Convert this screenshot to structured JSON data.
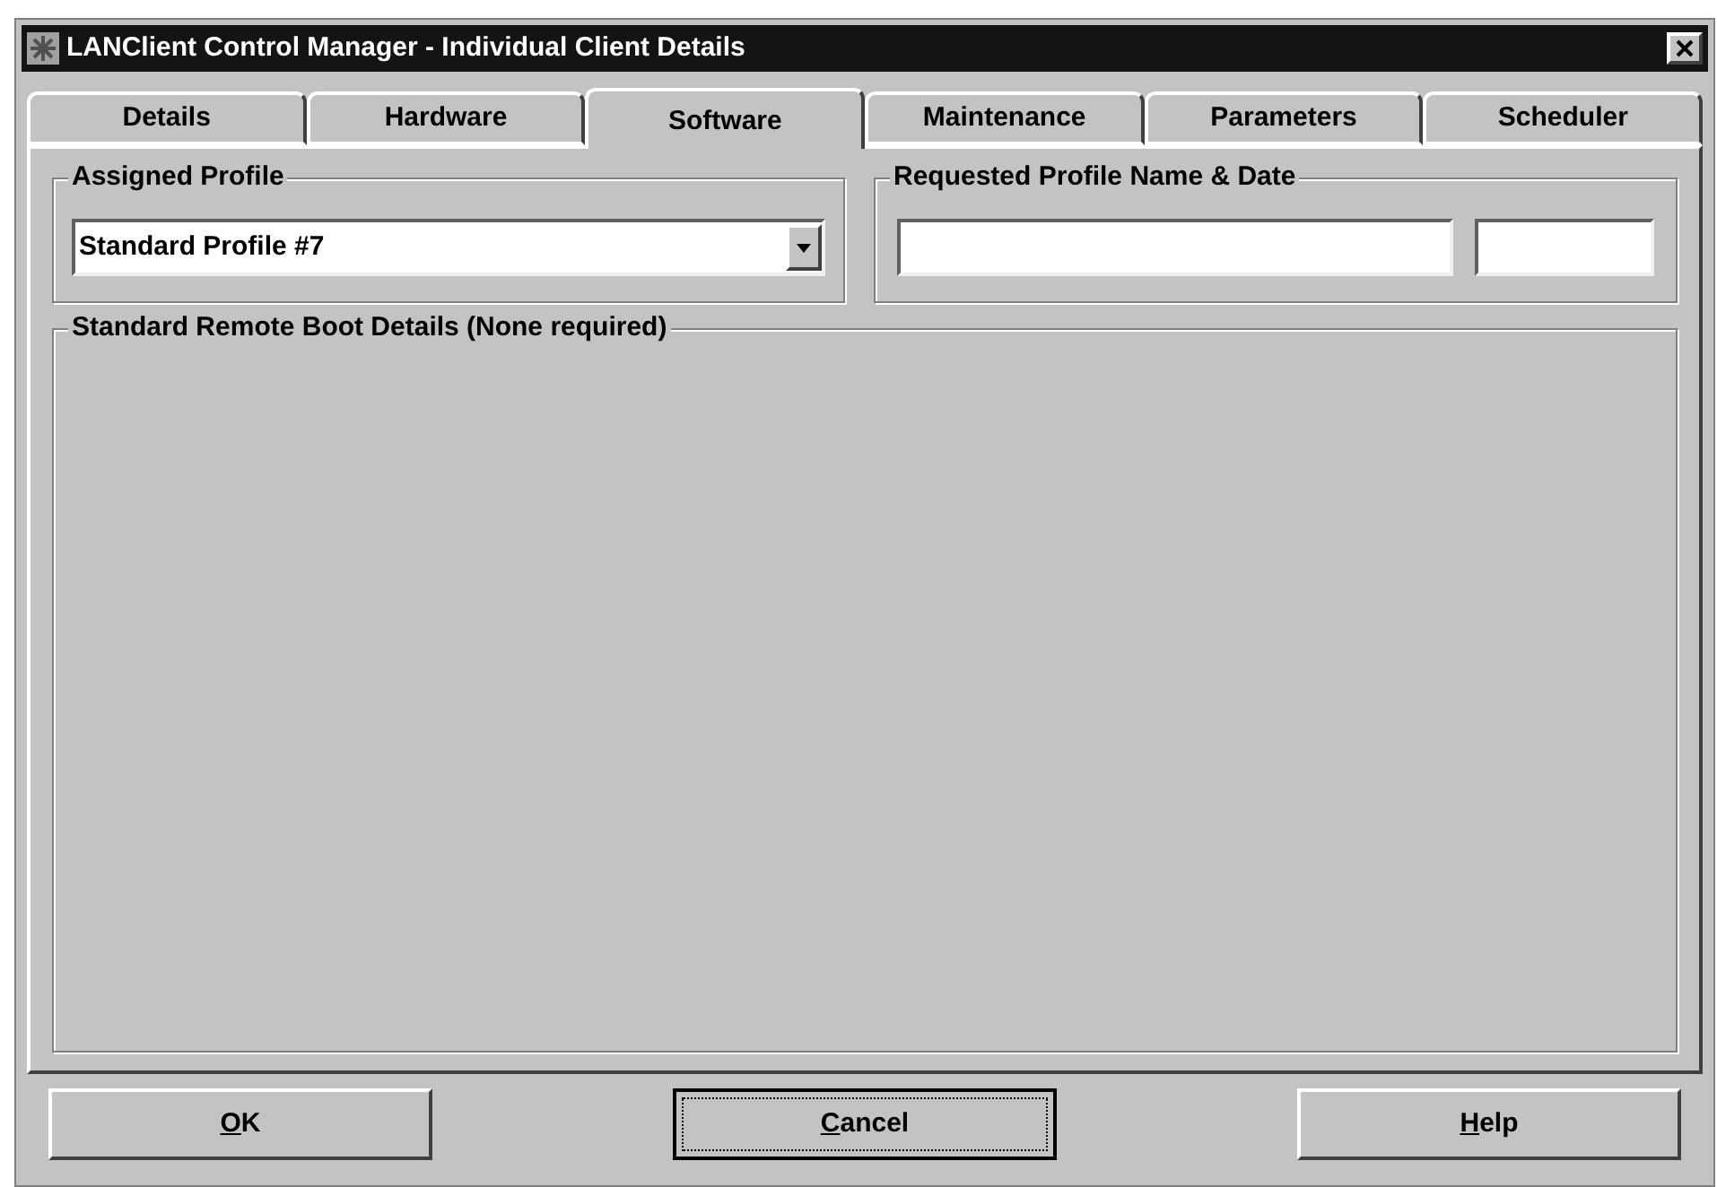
{
  "window": {
    "title": "LANClient Control Manager - Individual Client Details"
  },
  "tabs": [
    {
      "label": "Details",
      "selected": false
    },
    {
      "label": "Hardware",
      "selected": false
    },
    {
      "label": "Software",
      "selected": true
    },
    {
      "label": "Maintenance",
      "selected": false
    },
    {
      "label": "Parameters",
      "selected": false
    },
    {
      "label": "Scheduler",
      "selected": false
    }
  ],
  "assigned_profile": {
    "legend": "Assigned Profile",
    "value": "Standard Profile #7"
  },
  "requested_profile": {
    "legend": "Requested Profile Name & Date"
  },
  "boot_details": {
    "legend": "Standard Remote Boot Details (None required)"
  },
  "buttons": [
    {
      "accel": "O",
      "rest": "K",
      "default": false
    },
    {
      "accel": "C",
      "rest": "ancel",
      "default": true
    },
    {
      "accel": "H",
      "rest": "elp",
      "default": false
    }
  ]
}
